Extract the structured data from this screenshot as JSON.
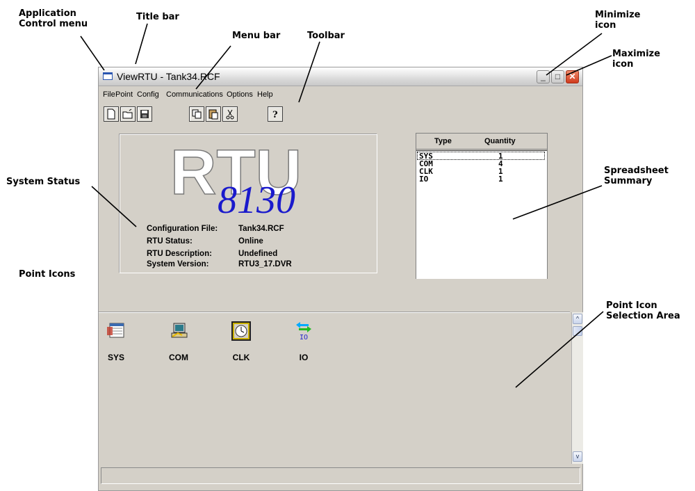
{
  "annotations": {
    "app_control_menu": [
      "Application",
      "Control menu"
    ],
    "title_bar": "Title bar",
    "menu_bar": "Menu bar",
    "toolbar": "Toolbar",
    "minimize": [
      "Minimize",
      "icon"
    ],
    "maximize": [
      "Maximize",
      "icon"
    ],
    "system_status": "System Status",
    "spreadsheet_summary": [
      "Spreadsheet",
      "Summary"
    ],
    "point_icons": "Point Icons",
    "selection_area": [
      "Point Icon",
      "Selection Area"
    ]
  },
  "window": {
    "title": "ViewRTU - Tank34.RCF",
    "controls": {
      "minimize": "_",
      "maximize": "□",
      "close": "✕"
    }
  },
  "menu": [
    "File",
    "Point",
    "Config",
    "Communications",
    "Options",
    "Help"
  ],
  "toolbar": {
    "buttons": [
      {
        "icon": "new-file-icon"
      },
      {
        "icon": "open-folder-icon"
      },
      {
        "icon": "save-disk-icon"
      },
      {
        "icon": "copy-icon"
      },
      {
        "icon": "paste-icon"
      },
      {
        "icon": "cut-scissors-icon"
      },
      {
        "icon": "help-icon"
      }
    ]
  },
  "logo": {
    "word": "RTU",
    "model": "8130"
  },
  "status": [
    {
      "label": "Configuration File:",
      "value": "Tank34.RCF"
    },
    {
      "label": "RTU Status:",
      "value": "Online"
    },
    {
      "label": "RTU Description:",
      "value": "Undefined"
    },
    {
      "label": "System Version:",
      "value": "RTU3_17.DVR"
    }
  ],
  "summary": {
    "headers": [
      "Type",
      "Quantity"
    ],
    "rows": [
      {
        "type": "SYS",
        "qty": "1"
      },
      {
        "type": "COM",
        "qty": "4"
      },
      {
        "type": "CLK",
        "qty": "1"
      },
      {
        "type": "IO",
        "qty": "1"
      }
    ]
  },
  "point_icons": [
    {
      "label": "SYS",
      "icon": "sys-point-icon"
    },
    {
      "label": "COM",
      "icon": "com-point-icon"
    },
    {
      "label": "CLK",
      "icon": "clock-point-icon"
    },
    {
      "label": "IO",
      "icon": "io-arrows-icon",
      "glyph_text": "IO"
    }
  ],
  "scroll": {
    "up": "^",
    "down": "v"
  },
  "colors": {
    "logo_blue": "#1a1acc",
    "close_red": "#d03a1c",
    "io_cyan": "#00aaff",
    "io_green": "#22bb22"
  }
}
